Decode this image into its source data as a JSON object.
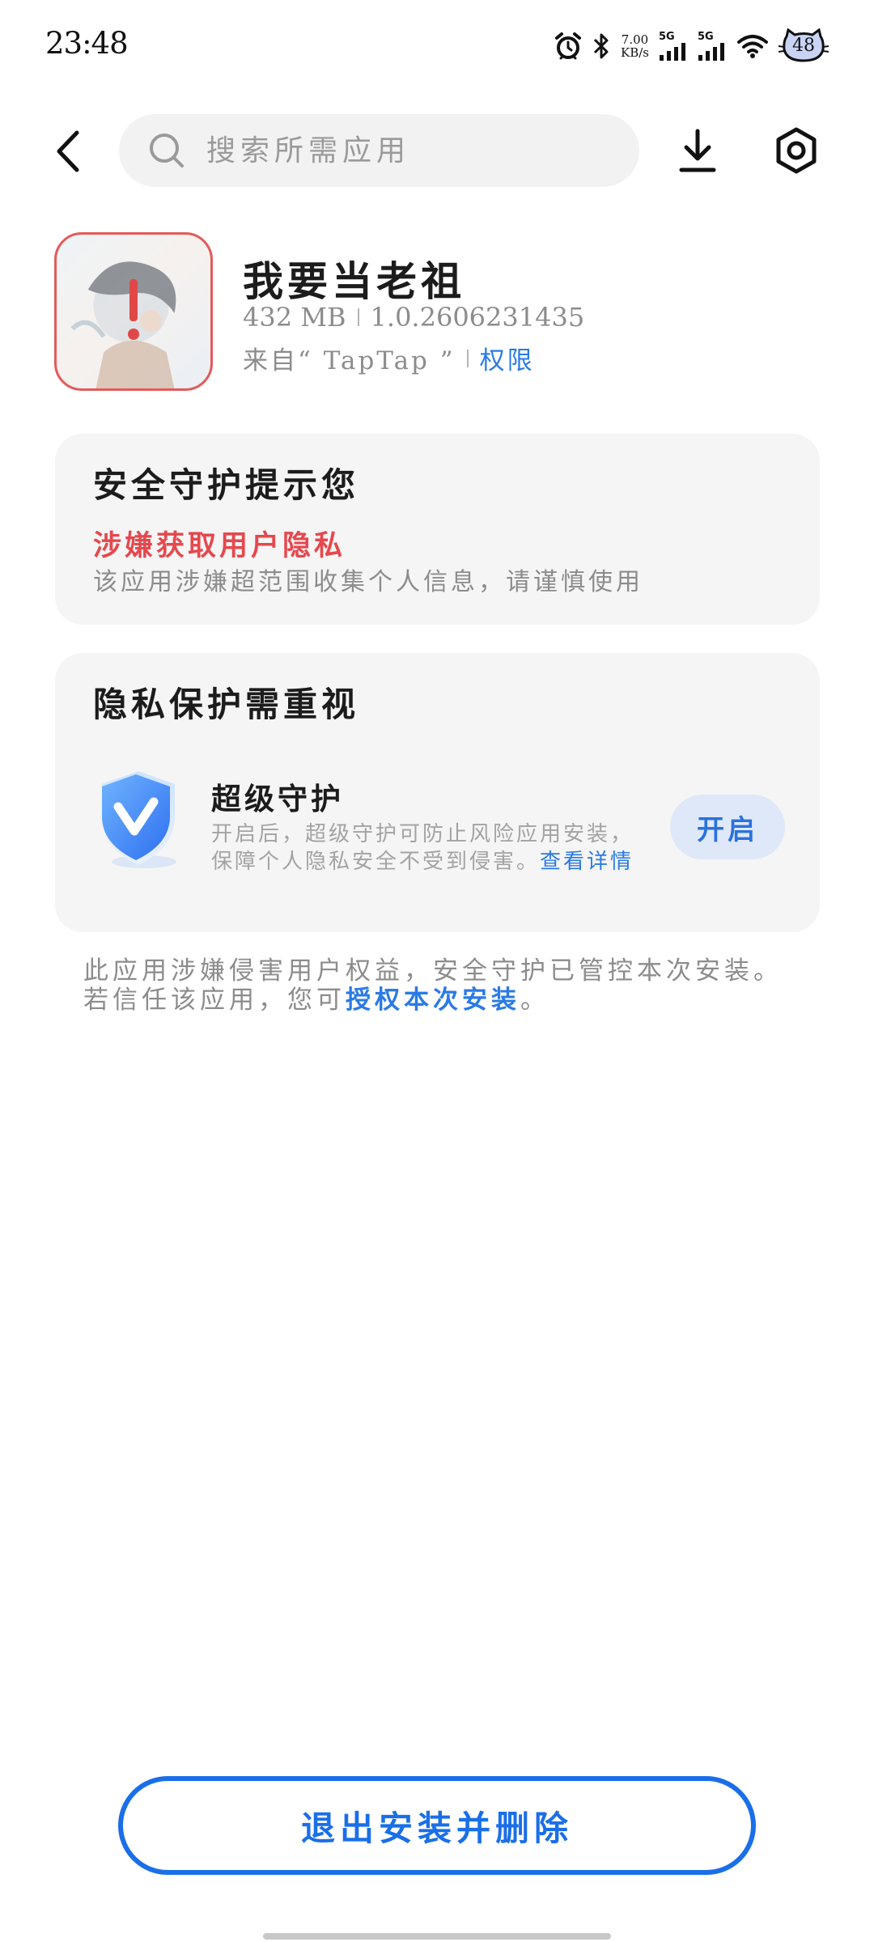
{
  "status_bar": {
    "time": "23:48",
    "net_speed_value": "7.00",
    "net_speed_unit": "KB/s",
    "sim1_label": "5G",
    "sim2_label": "5G",
    "battery": "48"
  },
  "search": {
    "placeholder": "搜索所需应用"
  },
  "app": {
    "name": "我要当老祖",
    "size": "432 MB",
    "version": "1.0.2606231435",
    "source": "来自“ TapTap ”",
    "permissions_link": "权限"
  },
  "security_card": {
    "title": "安全守护提示您",
    "risk_title": "涉嫌获取用户隐私",
    "risk_description": "该应用涉嫌超范围收集个人信息，请谨慎使用"
  },
  "privacy_card": {
    "title": "隐私保护需重视",
    "guard_title": "超级守护",
    "guard_description": "开启后，超级守护可防止风险应用安装，保障个人隐私安全不受到侵害。",
    "detail_link": "查看详情",
    "enable_button": "开启"
  },
  "notice": {
    "text": "此应用涉嫌侵害用户权益，安全守护已管控本次安装。若信任该应用，您可",
    "auth_link": "授权本次安装",
    "suffix": "。"
  },
  "bottom": {
    "exit_button": "退出安装并删除"
  },
  "colors": {
    "accent_blue": "#1a6fe8",
    "link_blue": "#2a7ae6",
    "risk_red": "#e5484d",
    "card_bg": "#f5f5f5"
  }
}
